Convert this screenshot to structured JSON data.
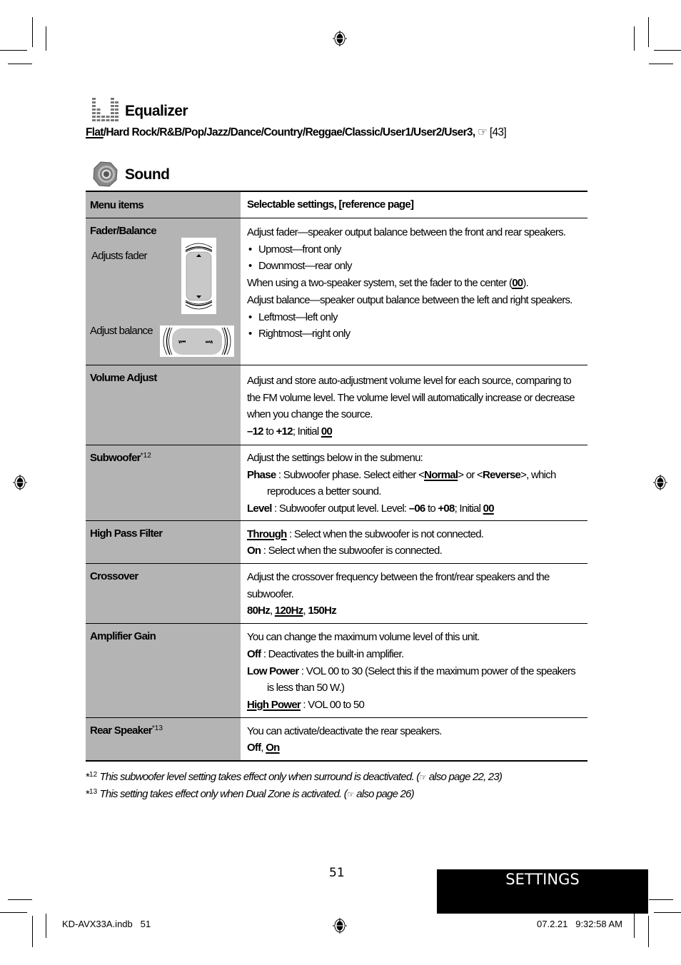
{
  "equalizer": {
    "title": "Equalizer",
    "options": [
      "Flat",
      "Hard Rock",
      "R&B",
      "Pop",
      "Jazz",
      "Dance",
      "Country",
      "Reggae",
      "Classic",
      "User1",
      "User2",
      "User3"
    ],
    "default_option": "Flat",
    "ref_icon": "☞",
    "ref": "[43]"
  },
  "sound": {
    "title": "Sound",
    "table": {
      "headers": [
        "Menu items",
        "Selectable settings, [reference page]"
      ],
      "fader_balance": {
        "name": "Fader/Balance",
        "fader_caption": "Adjusts fader",
        "balance_caption": "Adjust balance",
        "balance_left_glyph": "∨⏮",
        "balance_right_glyph": "⏭∧",
        "lines": {
          "l1": "Adjust fader—speaker output balance between the front and rear speakers.",
          "b1": "Upmost—front only",
          "b2": "Downmost—rear only",
          "l2_pre": "When using a two-speaker system, set the fader to the center (",
          "l2_val": "00",
          "l2_post": ").",
          "l3": "Adjust balance—speaker output balance between the left and right speakers.",
          "b3": "Leftmost—left only",
          "b4": "Rightmost—right only"
        }
      },
      "volume_adjust": {
        "name": "Volume Adjust",
        "text": "Adjust and store auto-adjustment volume level for each source, comparing to the FM volume level. The volume level will automatically increase or decrease when you change the source.",
        "min": "–12",
        "to": " to ",
        "max": "+12",
        "initial_label": "; Initial ",
        "initial": "00"
      },
      "subwoofer": {
        "name": "Subwoofer",
        "note": "*12",
        "intro": "Adjust the settings below in the submenu:",
        "phase_label": "Phase",
        "phase_text_pre": " : Subwoofer phase. Select either <",
        "phase_opt1": "Normal",
        "phase_mid": "> or <",
        "phase_opt2": "Reverse",
        "phase_text_post": ">, which reproduces a better sound.",
        "level_label": "Level",
        "level_text": " : Subwoofer output level. Level: ",
        "level_min": "–06",
        "level_to": " to ",
        "level_max": "+08",
        "level_initial_label": "; Initial ",
        "level_initial": "00"
      },
      "high_pass_filter": {
        "name": "High Pass Filter",
        "opt1": "Through",
        "opt1_text": " : Select when the subwoofer is not connected.",
        "opt2": "On",
        "opt2_text": " : Select when the subwoofer is connected."
      },
      "crossover": {
        "name": "Crossover",
        "text": "Adjust the crossover frequency between the front/rear speakers and the subwoofer.",
        "options": [
          "80Hz",
          "120Hz",
          "150Hz"
        ],
        "default_option": "120Hz"
      },
      "amplifier_gain": {
        "name": "Amplifier Gain",
        "intro": "You can change the maximum volume level of this unit.",
        "off_label": "Off",
        "off_text": " : Deactivates the built-in amplifier.",
        "low_label": "Low Power",
        "low_text": " : VOL 00 to 30 (Select this if the maximum power of the speakers is less than 50 W.)",
        "high_label": "High Power",
        "high_text": " : VOL 00 to 50"
      },
      "rear_speaker": {
        "name": "Rear Speaker",
        "note": "*13",
        "intro": "You can activate/deactivate the rear speakers.",
        "opt1": "Off",
        "opt2": "On"
      }
    }
  },
  "footnotes": [
    {
      "mark": "*",
      "num": "12",
      "text": "This subwoofer level setting takes effect only when surround is deactivated. (",
      "ref_icon": "☞",
      "ref": " also page 22, 23)"
    },
    {
      "mark": "*",
      "num": "13",
      "text": "This setting takes effect only when Dual Zone is activated. (",
      "ref_icon": "☞",
      "ref": " also page 26)"
    }
  ],
  "page": {
    "number": "51",
    "section_tab": "SETTINGS",
    "slug_left": "KD-AVX33A.indb   51",
    "slug_right": "07.2.21   9:32:58 AM"
  }
}
